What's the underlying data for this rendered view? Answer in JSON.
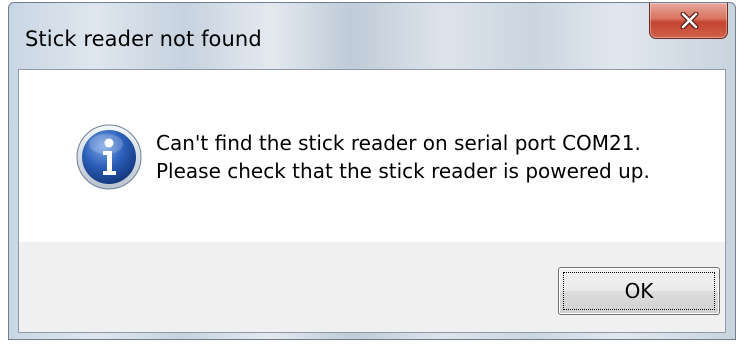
{
  "window": {
    "title": "Stick reader not found",
    "close_icon": "close-icon"
  },
  "dialog": {
    "icon": "info-icon",
    "message_line1": "Can't find the stick reader on serial port COM21.",
    "message_line2": "Please check that the stick reader is powered up.",
    "ok_label": "OK"
  },
  "colors": {
    "close_button": "#c3452f",
    "info_icon": "#2a5eb8"
  }
}
